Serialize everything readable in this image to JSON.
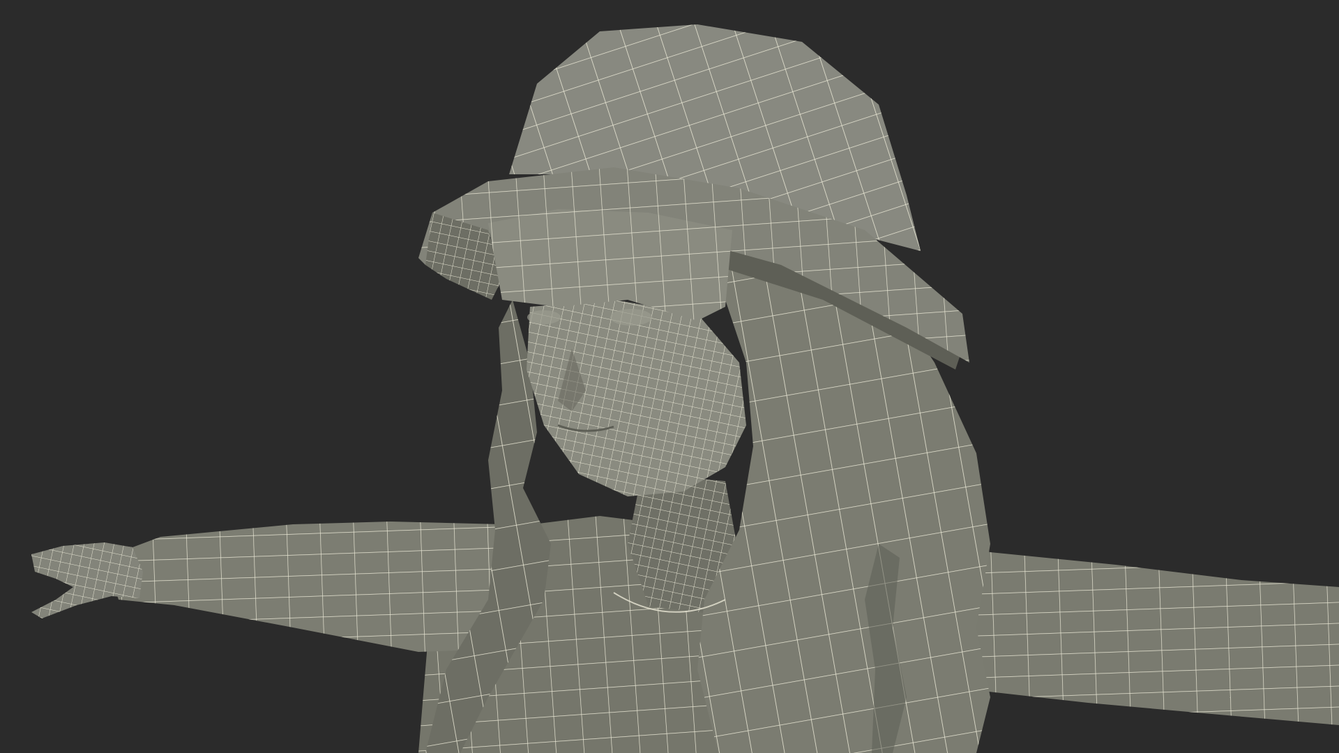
{
  "scene": {
    "subject": "wireframe-character-bust",
    "colors": {
      "background": "#2b2b2b",
      "surface": "#7c7d72",
      "surface_light": "#8a8b80",
      "surface_dark": "#66675d",
      "shadow": "#505148",
      "wire": "#e8e6d4"
    }
  }
}
